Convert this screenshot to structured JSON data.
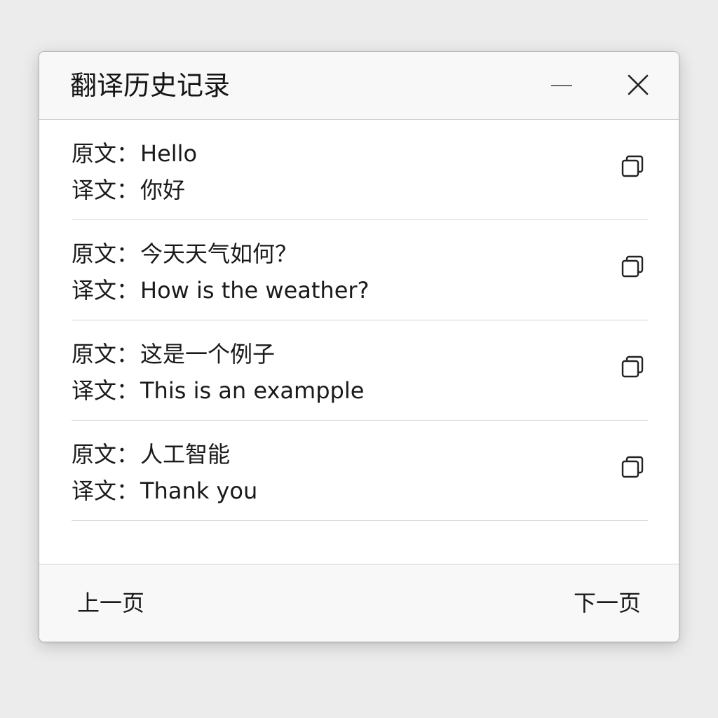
{
  "window": {
    "title": "翻译历史记录"
  },
  "controls": {
    "minimize_icon": "minimize-icon",
    "close_icon": "close-icon"
  },
  "history": {
    "source_label": "原文：",
    "target_label": "译文：",
    "copy_icon": "copy-icon",
    "entries": [
      {
        "source": "Hello",
        "target": "你好"
      },
      {
        "source": "今天天气如何？",
        "target": "How is the weather?"
      },
      {
        "source": "这是一个例子",
        "target": "This is an exampple"
      },
      {
        "source": "人工智能",
        "target": "Thank you"
      }
    ]
  },
  "pagination": {
    "prev_label": "上一页",
    "next_label": "下一页"
  },
  "colors": {
    "background": "#ececec",
    "window": "#ffffff",
    "bars": "#f8f8f8",
    "divider": "#d6d6d6",
    "text": "#1a1a1a"
  }
}
